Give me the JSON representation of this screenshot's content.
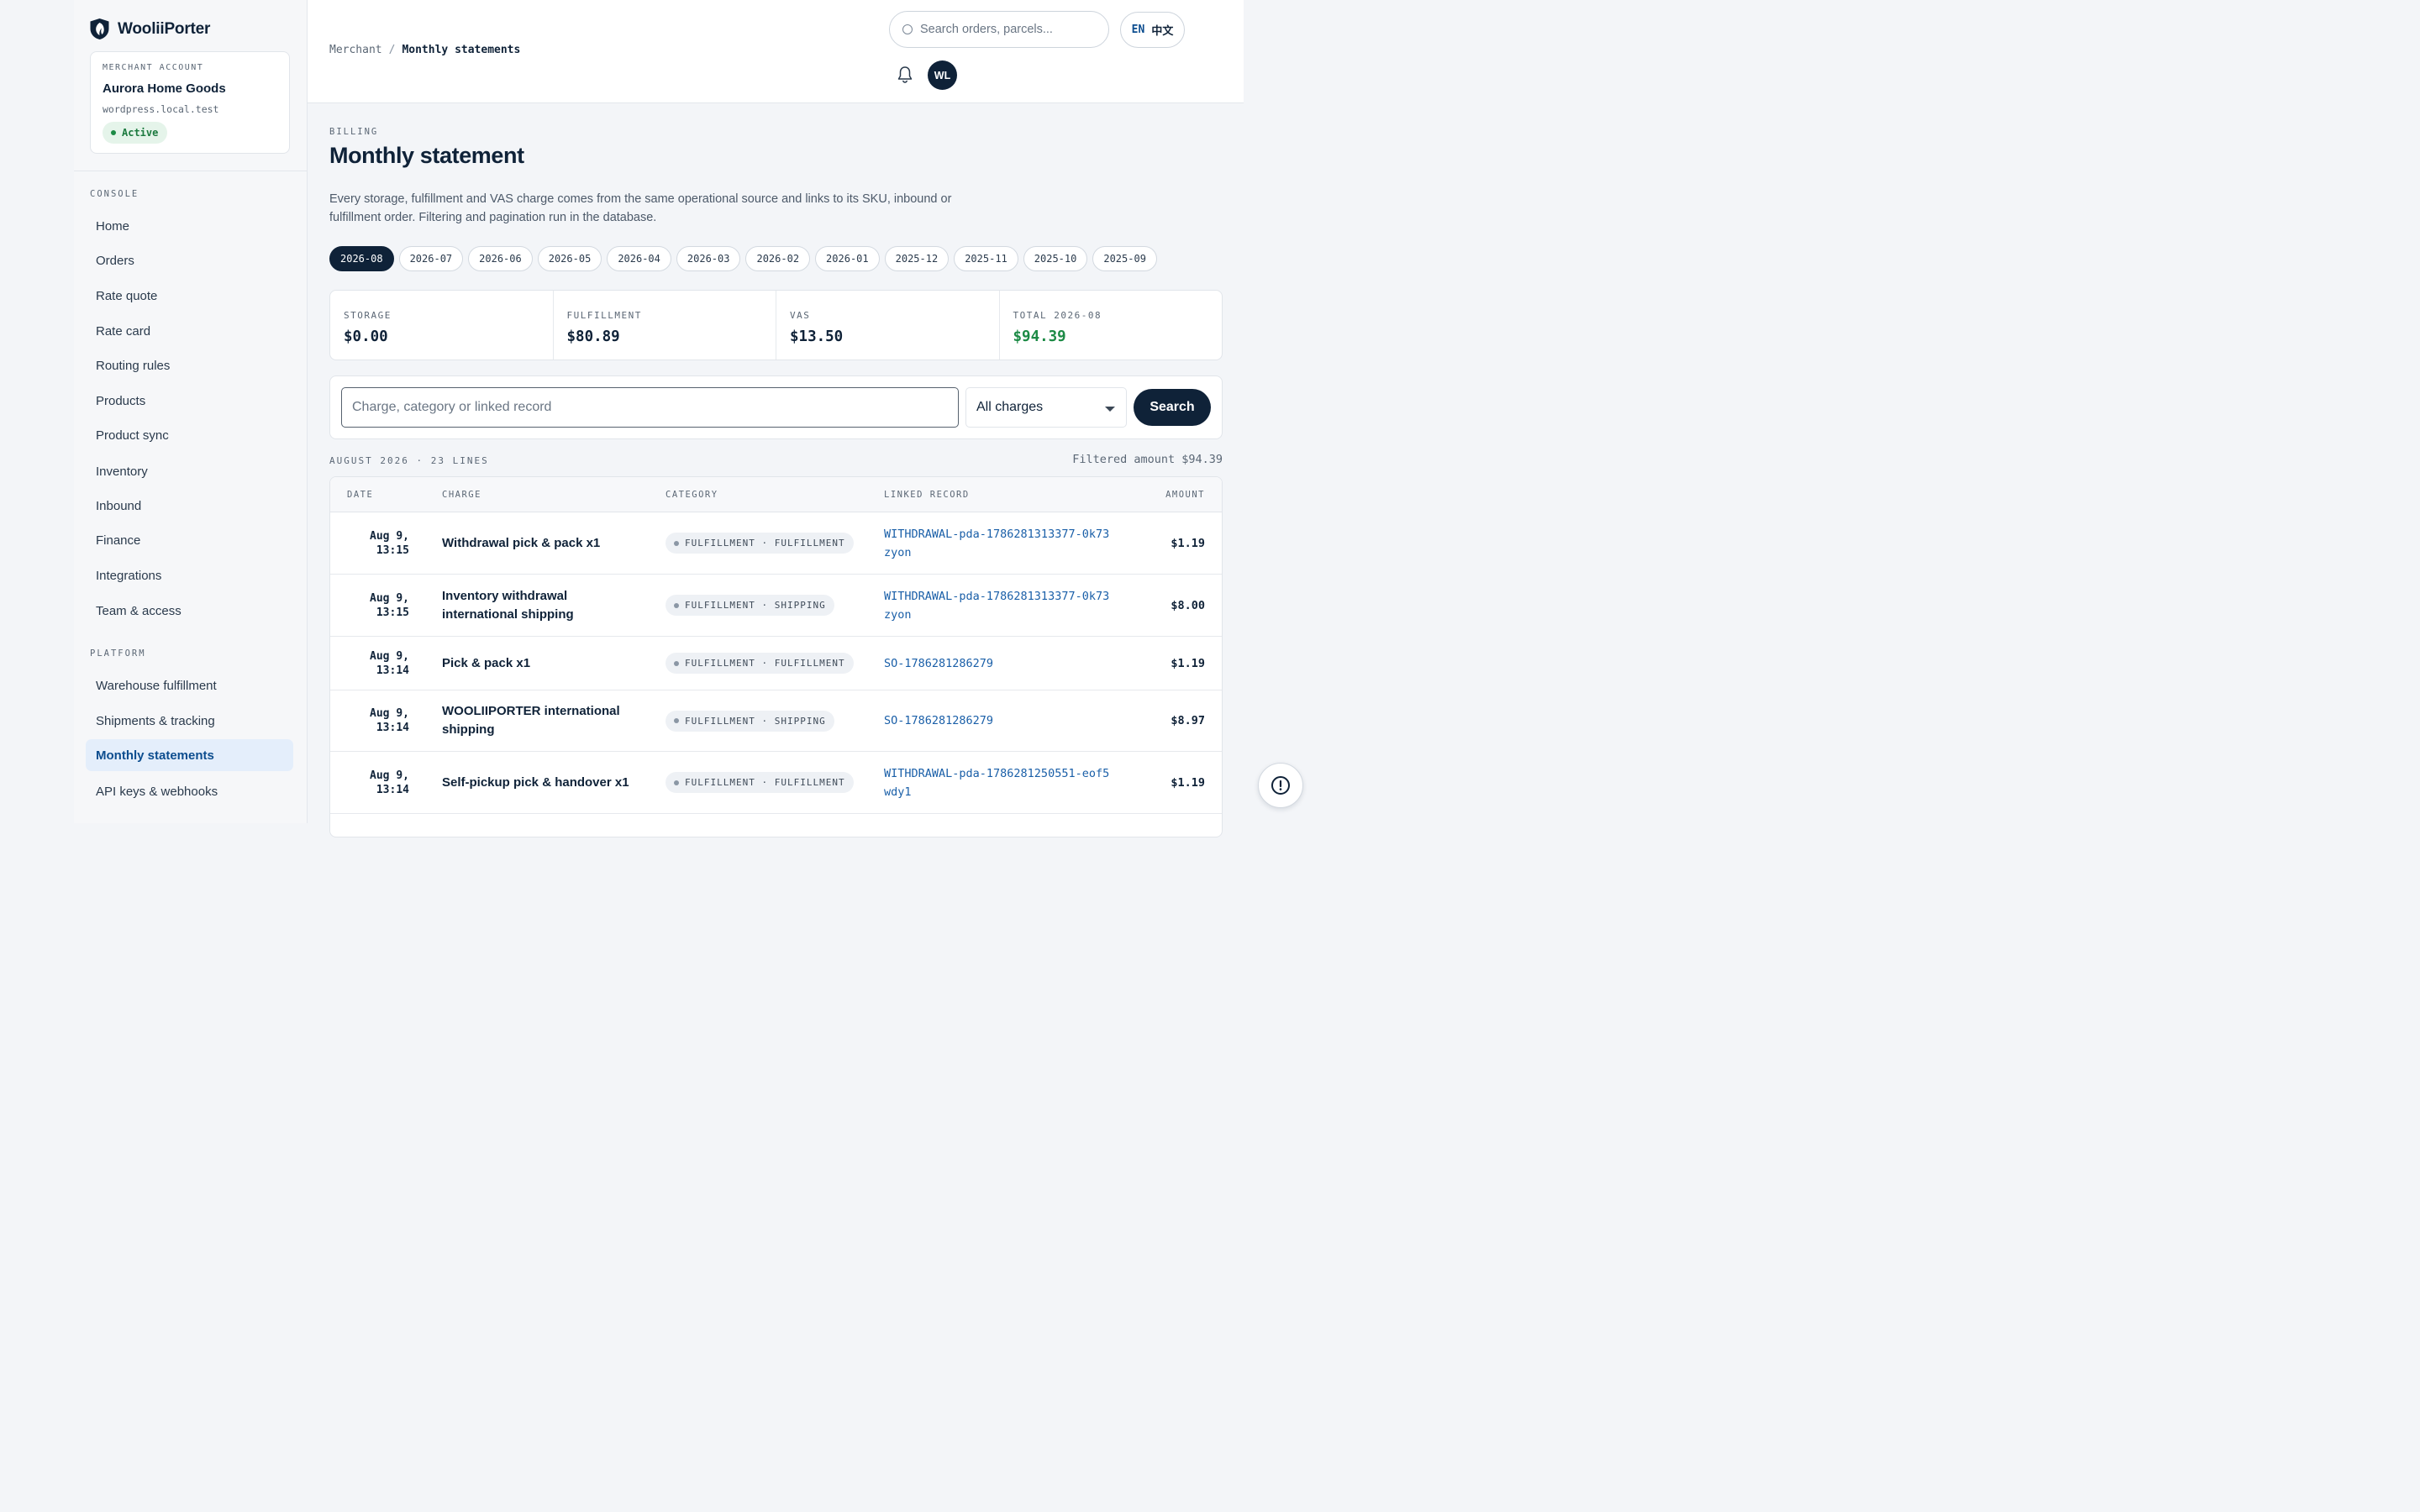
{
  "brand": {
    "name": "WooliiPorter"
  },
  "merchant": {
    "label": "MERCHANT ACCOUNT",
    "name": "Aurora Home Goods",
    "domain": "wordpress.local.test",
    "status": "Active"
  },
  "sidebar": {
    "console_label": "CONSOLE",
    "console_items": [
      {
        "label": "Home"
      },
      {
        "label": "Orders"
      },
      {
        "label": "Rate quote"
      },
      {
        "label": "Rate card"
      },
      {
        "label": "Routing rules"
      },
      {
        "label": "Products"
      },
      {
        "label": "Product sync"
      },
      {
        "label": "Inventory"
      },
      {
        "label": "Inbound"
      },
      {
        "label": "Finance"
      },
      {
        "label": "Integrations"
      },
      {
        "label": "Team & access"
      }
    ],
    "platform_label": "PLATFORM",
    "platform_items": [
      {
        "label": "Warehouse fulfillment"
      },
      {
        "label": "Shipments & tracking"
      },
      {
        "label": "Monthly statements",
        "active": true
      },
      {
        "label": "API keys & webhooks"
      }
    ]
  },
  "topbar": {
    "breadcrumb_root": "Merchant",
    "breadcrumb_sep": "/",
    "breadcrumb_current": "Monthly statements",
    "search_placeholder": "Search orders, parcels...",
    "lang_en": "EN",
    "lang_zh": "中文",
    "avatar_initials": "WL"
  },
  "page": {
    "eyebrow": "BILLING",
    "title": "Monthly statement",
    "description": "Every storage, fulfillment and VAS charge comes from the same operational source and links to its SKU, inbound or fulfillment order. Filtering and pagination run in the database."
  },
  "months": [
    "2026-08",
    "2026-07",
    "2026-06",
    "2026-05",
    "2026-04",
    "2026-03",
    "2026-02",
    "2026-01",
    "2025-12",
    "2025-11",
    "2025-10",
    "2025-09"
  ],
  "active_month": "2026-08",
  "stats": [
    {
      "label": "STORAGE",
      "value": "$0.00"
    },
    {
      "label": "FULFILLMENT",
      "value": "$80.89"
    },
    {
      "label": "VAS",
      "value": "$13.50"
    },
    {
      "label": "TOTAL 2026-08",
      "value": "$94.39",
      "color": "#1c8a45"
    }
  ],
  "filter": {
    "input_placeholder": "Charge, category or linked record",
    "select_value": "All charges",
    "button_label": "Search"
  },
  "summary": {
    "left": "AUGUST 2026 · 23 LINES",
    "right": "Filtered amount $94.39"
  },
  "table": {
    "columns": [
      "DATE",
      "CHARGE",
      "CATEGORY",
      "LINKED RECORD",
      "AMOUNT"
    ],
    "rows": [
      {
        "date1": "Aug 9,",
        "date2": "13:15",
        "charge": "Withdrawal pick & pack x1",
        "category": "FULFILLMENT · FULFILLMENT",
        "link": "WITHDRAWAL-pda-1786281313377-0k73zyon",
        "amount": "$1.19"
      },
      {
        "date1": "Aug 9,",
        "date2": "13:15",
        "charge": "Inventory withdrawal international shipping",
        "category": "FULFILLMENT · SHIPPING",
        "link": "WITHDRAWAL-pda-1786281313377-0k73zyon",
        "amount": "$8.00"
      },
      {
        "date1": "Aug 9,",
        "date2": "13:14",
        "charge": "Pick & pack x1",
        "category": "FULFILLMENT · FULFILLMENT",
        "link": "SO-1786281286279",
        "amount": "$1.19"
      },
      {
        "date1": "Aug 9,",
        "date2": "13:14",
        "charge": "WOOLIIPORTER international shipping",
        "category": "FULFILLMENT · SHIPPING",
        "link": "SO-1786281286279",
        "amount": "$8.97"
      },
      {
        "date1": "Aug 9,",
        "date2": "13:14",
        "charge": "Self-pickup pick & handover x1",
        "category": "FULFILLMENT · FULFILLMENT",
        "link": "WITHDRAWAL-pda-1786281250551-eof5wdy1",
        "amount": "$1.19"
      }
    ]
  },
  "colors": {
    "navy": "#0f2238",
    "link": "#1a5fa8",
    "green": "#1c8a45",
    "active_bg": "#e4eefb"
  }
}
